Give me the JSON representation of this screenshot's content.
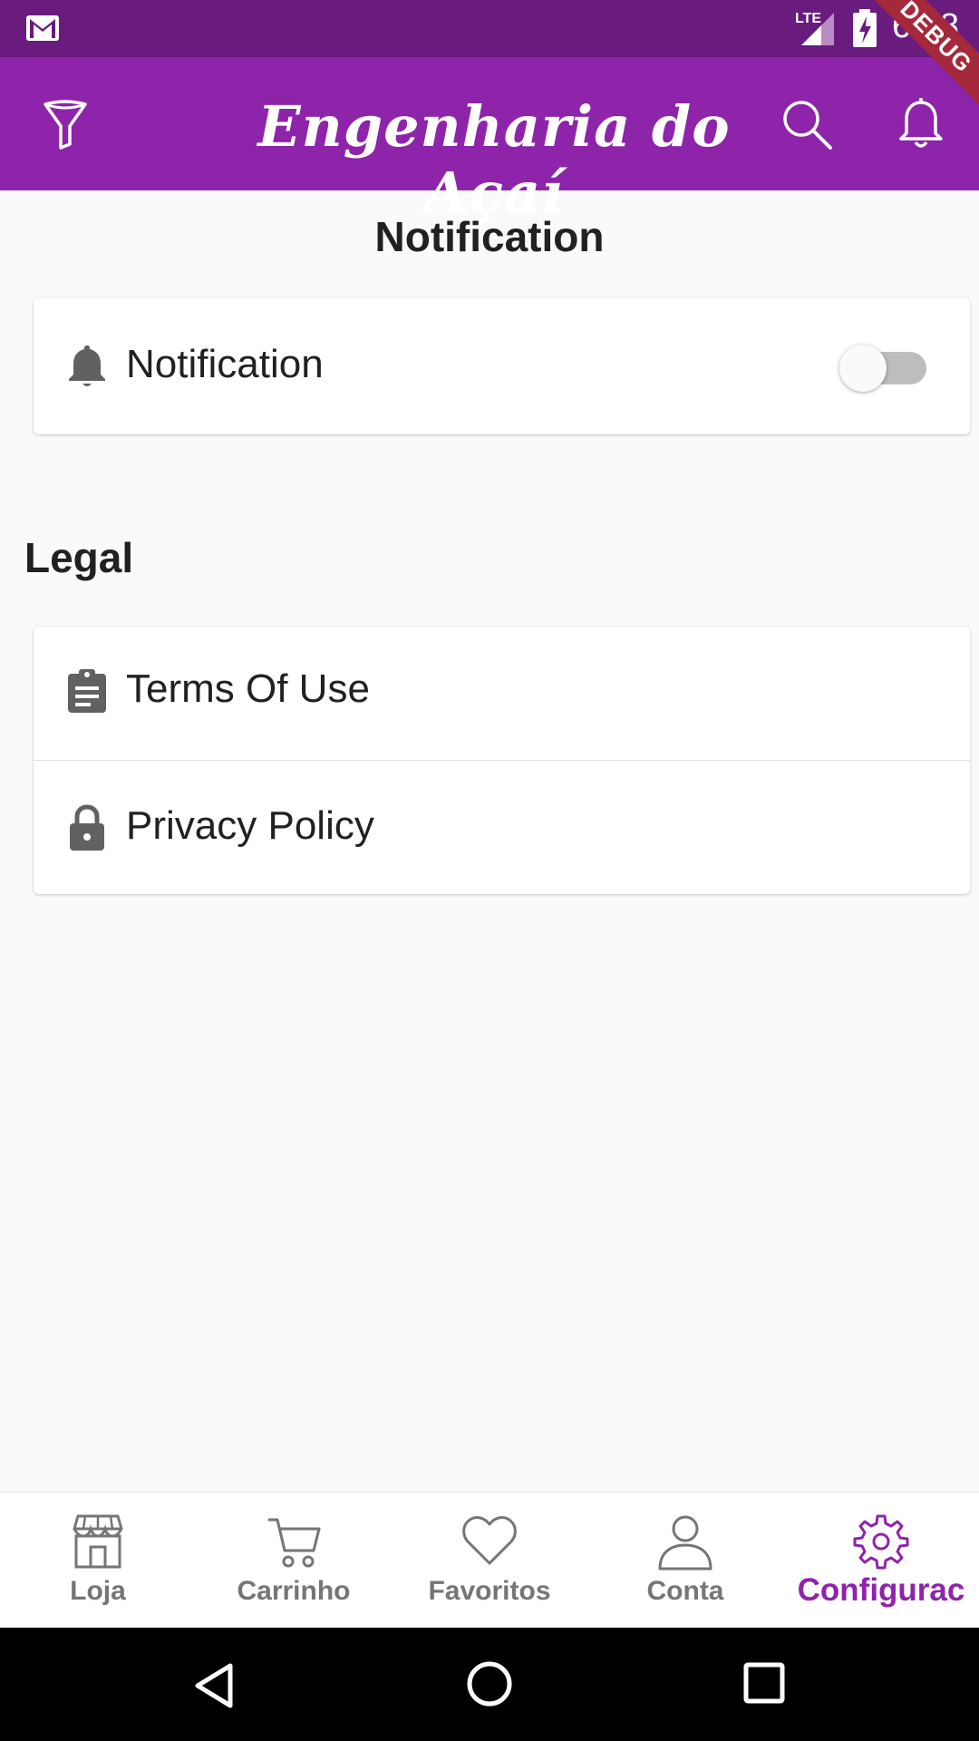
{
  "status_bar": {
    "time": "6:58",
    "network": "LTE",
    "debug_banner": "DEBUG"
  },
  "app_bar": {
    "title": "Engenharia do Açaí",
    "icons": [
      "filter-icon",
      "search-icon",
      "bell-icon"
    ]
  },
  "notification_section": {
    "title": "Notification",
    "item": {
      "label": "Notification",
      "icon": "bell-icon",
      "toggle_on": false
    }
  },
  "legal_section": {
    "title": "Legal",
    "items": [
      {
        "label": "Terms Of Use",
        "icon": "clipboard-icon"
      },
      {
        "label": "Privacy Policy",
        "icon": "lock-icon"
      }
    ]
  },
  "bottom_nav": {
    "items": [
      {
        "label": "Loja",
        "icon": "store-icon"
      },
      {
        "label": "Carrinho",
        "icon": "cart-icon"
      },
      {
        "label": "Favoritos",
        "icon": "heart-icon"
      },
      {
        "label": "Conta",
        "icon": "person-icon"
      },
      {
        "label": "Configurac",
        "icon": "gear-icon",
        "active": true
      }
    ]
  },
  "colors": {
    "primary": "#8e24aa",
    "status_bar": "#6a1b7e",
    "inactive": "#757575"
  }
}
